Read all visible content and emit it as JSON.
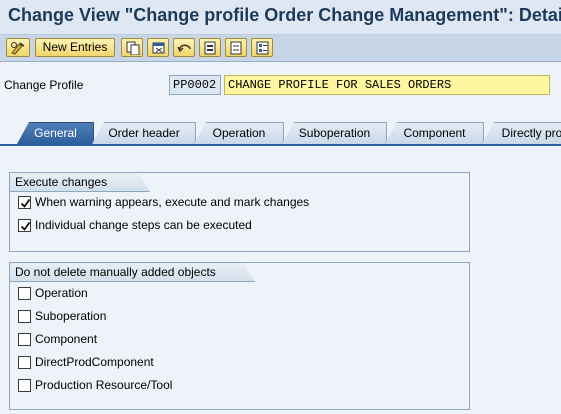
{
  "title": "Change View \"Change profile Order Change Management\": Details",
  "toolbar": {
    "new_entries_label": "New Entries",
    "icons": [
      "display-change-icon",
      "copy-icon",
      "delete-icon",
      "undo-icon",
      "select-all-icon",
      "deselect-icon",
      "config-icon"
    ]
  },
  "profile": {
    "label": "Change Profile",
    "code": "PP0002",
    "description": "CHANGE PROFILE FOR SALES ORDERS"
  },
  "tabs": [
    {
      "label": "General",
      "active": true
    },
    {
      "label": "Order header"
    },
    {
      "label": "Operation"
    },
    {
      "label": "Suboperation"
    },
    {
      "label": "Component"
    },
    {
      "label": "Directly pro"
    }
  ],
  "execute_group": {
    "title": "Execute changes",
    "items": [
      {
        "label": "When warning appears, execute and mark changes",
        "checked": true
      },
      {
        "label": "Individual change steps can be executed",
        "checked": true
      }
    ]
  },
  "delete_group": {
    "title": "Do not delete manually added objects",
    "items": [
      {
        "label": "Operation",
        "checked": false
      },
      {
        "label": "Suboperation",
        "checked": false
      },
      {
        "label": "Component",
        "checked": false
      },
      {
        "label": "DirectProdComponent",
        "checked": false
      },
      {
        "label": "Production Resource/Tool",
        "checked": false
      }
    ]
  }
}
